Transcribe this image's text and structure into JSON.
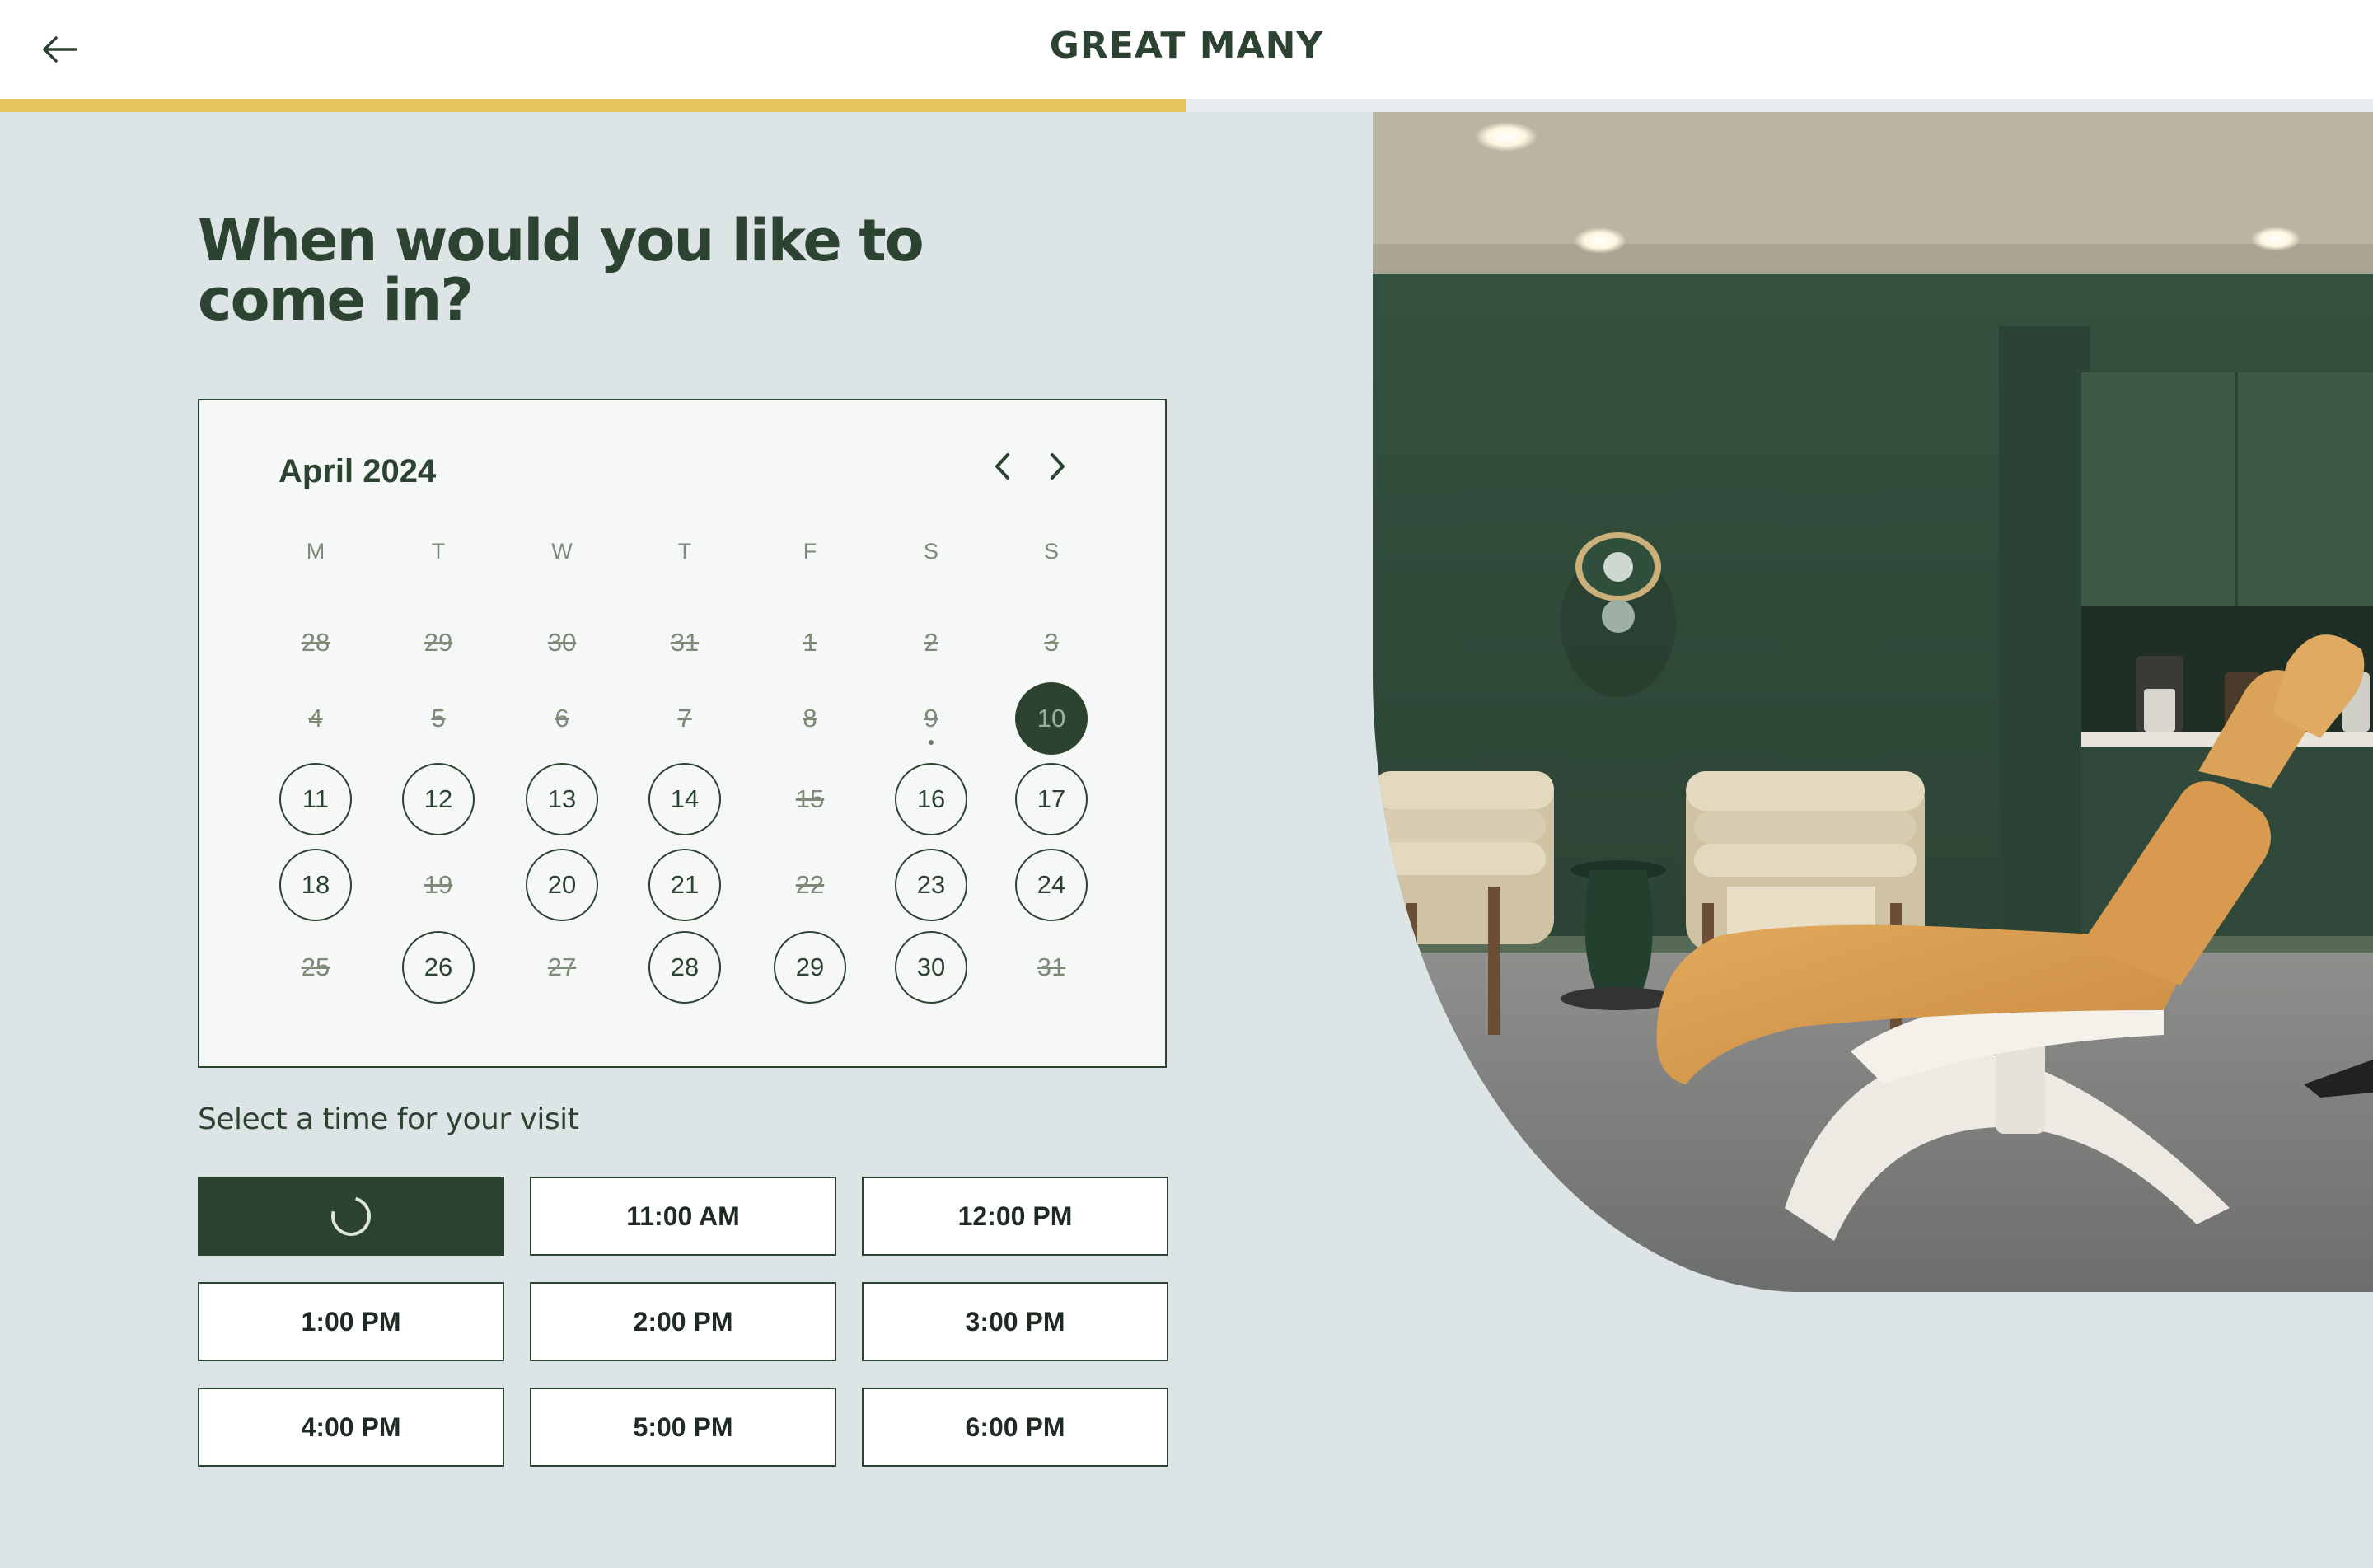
{
  "header": {
    "brand": "GREAT MANY",
    "back_icon": "arrow-left-icon",
    "progress_fraction": 0.5
  },
  "headline": "When would you like to come in?",
  "calendar": {
    "month_label": "April 2024",
    "prev_icon": "chevron-left-icon",
    "next_icon": "chevron-right-icon",
    "weekdays": [
      "M",
      "T",
      "W",
      "T",
      "F",
      "S",
      "S"
    ],
    "weeks": [
      [
        {
          "d": "28",
          "s": "off"
        },
        {
          "d": "29",
          "s": "off"
        },
        {
          "d": "30",
          "s": "off"
        },
        {
          "d": "31",
          "s": "off"
        },
        {
          "d": "1",
          "s": "off"
        },
        {
          "d": "2",
          "s": "off"
        },
        {
          "d": "3",
          "s": "off"
        }
      ],
      [
        {
          "d": "4",
          "s": "off"
        },
        {
          "d": "5",
          "s": "off"
        },
        {
          "d": "6",
          "s": "off"
        },
        {
          "d": "7",
          "s": "off"
        },
        {
          "d": "8",
          "s": "off"
        },
        {
          "d": "9",
          "s": "off",
          "today": true
        },
        {
          "d": "10",
          "s": "selected"
        }
      ],
      [
        {
          "d": "11",
          "s": "available"
        },
        {
          "d": "12",
          "s": "available"
        },
        {
          "d": "13",
          "s": "available"
        },
        {
          "d": "14",
          "s": "available"
        },
        {
          "d": "15",
          "s": "off"
        },
        {
          "d": "16",
          "s": "available"
        },
        {
          "d": "17",
          "s": "available"
        }
      ],
      [
        {
          "d": "18",
          "s": "available"
        },
        {
          "d": "19",
          "s": "off"
        },
        {
          "d": "20",
          "s": "available"
        },
        {
          "d": "21",
          "s": "available"
        },
        {
          "d": "22",
          "s": "off"
        },
        {
          "d": "23",
          "s": "available"
        },
        {
          "d": "24",
          "s": "available"
        }
      ],
      [
        {
          "d": "25",
          "s": "off"
        },
        {
          "d": "26",
          "s": "available"
        },
        {
          "d": "27",
          "s": "off"
        },
        {
          "d": "28",
          "s": "available"
        },
        {
          "d": "29",
          "s": "available"
        },
        {
          "d": "30",
          "s": "available"
        },
        {
          "d": "31",
          "s": "off"
        }
      ]
    ]
  },
  "time_section": {
    "label": "Select a time for your visit",
    "slots": [
      {
        "label": "",
        "state": "loading"
      },
      {
        "label": "11:00 AM"
      },
      {
        "label": "12:00 PM"
      },
      {
        "label": "1:00 PM"
      },
      {
        "label": "2:00 PM"
      },
      {
        "label": "3:00 PM"
      },
      {
        "label": "4:00 PM"
      },
      {
        "label": "5:00 PM"
      },
      {
        "label": "6:00 PM"
      }
    ]
  },
  "colors": {
    "brand_green": "#2d4332",
    "accent_yellow": "#e6c55c",
    "page_bg": "#dde4e5",
    "chair_orange": "#d89a4f"
  }
}
